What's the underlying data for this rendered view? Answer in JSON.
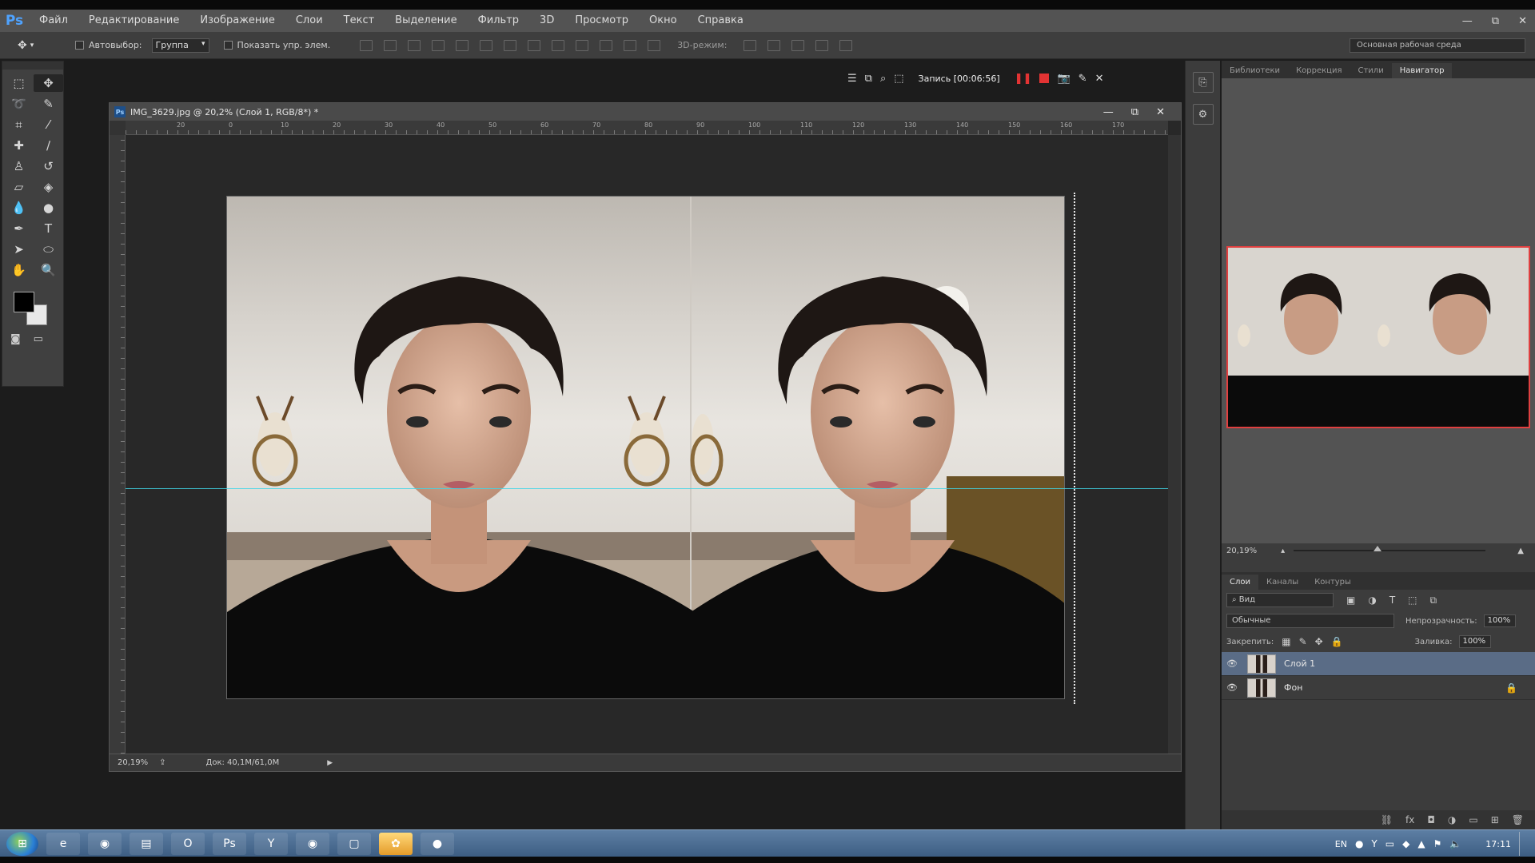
{
  "app": {
    "logo": "Ps"
  },
  "menu": [
    "Файл",
    "Редактирование",
    "Изображение",
    "Слои",
    "Текст",
    "Выделение",
    "Фильтр",
    "3D",
    "Просмотр",
    "Окно",
    "Справка"
  ],
  "window_controls": {
    "minimize": "—",
    "restore": "⧉",
    "close": "✕"
  },
  "options": {
    "autoselect_label": "Автовыбор:",
    "autoselect_value": "Группа",
    "show_controls_label": "Показать упр. элем.",
    "mode_3d_label": "3D-режим:",
    "workspace": "Основная рабочая среда"
  },
  "recording": {
    "text": "Запись [00:06:56]"
  },
  "document": {
    "title": "IMG_3629.jpg @ 20,2% (Слой 1, RGB/8*) *",
    "zoom": "20,19%",
    "doc_size": "Док: 40,1M/61,0M",
    "ruler_marks": [
      "20",
      "0",
      "10",
      "20",
      "30",
      "40",
      "50",
      "60",
      "70",
      "80",
      "90",
      "100",
      "110",
      "120",
      "130",
      "140",
      "150",
      "160",
      "170"
    ]
  },
  "panels": {
    "top_tabs": [
      "Библиотеки",
      "Коррекция",
      "Стили",
      "Навигатор"
    ],
    "active_top_tab": "Навигатор",
    "nav_zoom": "20,19%",
    "layer_tabs": [
      "Слои",
      "Каналы",
      "Контуры"
    ],
    "kind_label": "Вид",
    "blend_mode": "Обычные",
    "opacity_label": "Непрозрачность:",
    "opacity_value": "100%",
    "lock_label": "Закрепить:",
    "fill_label": "Заливка:",
    "fill_value": "100%",
    "layers": [
      {
        "name": "Слой 1",
        "selected": true,
        "locked": false
      },
      {
        "name": "Фон",
        "selected": false,
        "locked": true
      }
    ]
  },
  "taskbar": {
    "lang": "EN",
    "time": "17:11",
    "apps": [
      "ie-icon",
      "chrome-icon",
      "explorer-icon",
      "opera-icon",
      "photoshop-icon",
      "yandex-icon",
      "chrome2-icon",
      "window-icon",
      "paint-icon",
      "recorder-icon"
    ]
  },
  "colors": {
    "accent_blue": "#4fa3ff",
    "record_red": "#e23333",
    "guide": "#3fd6e6",
    "selected_layer": "#5a6c86"
  }
}
